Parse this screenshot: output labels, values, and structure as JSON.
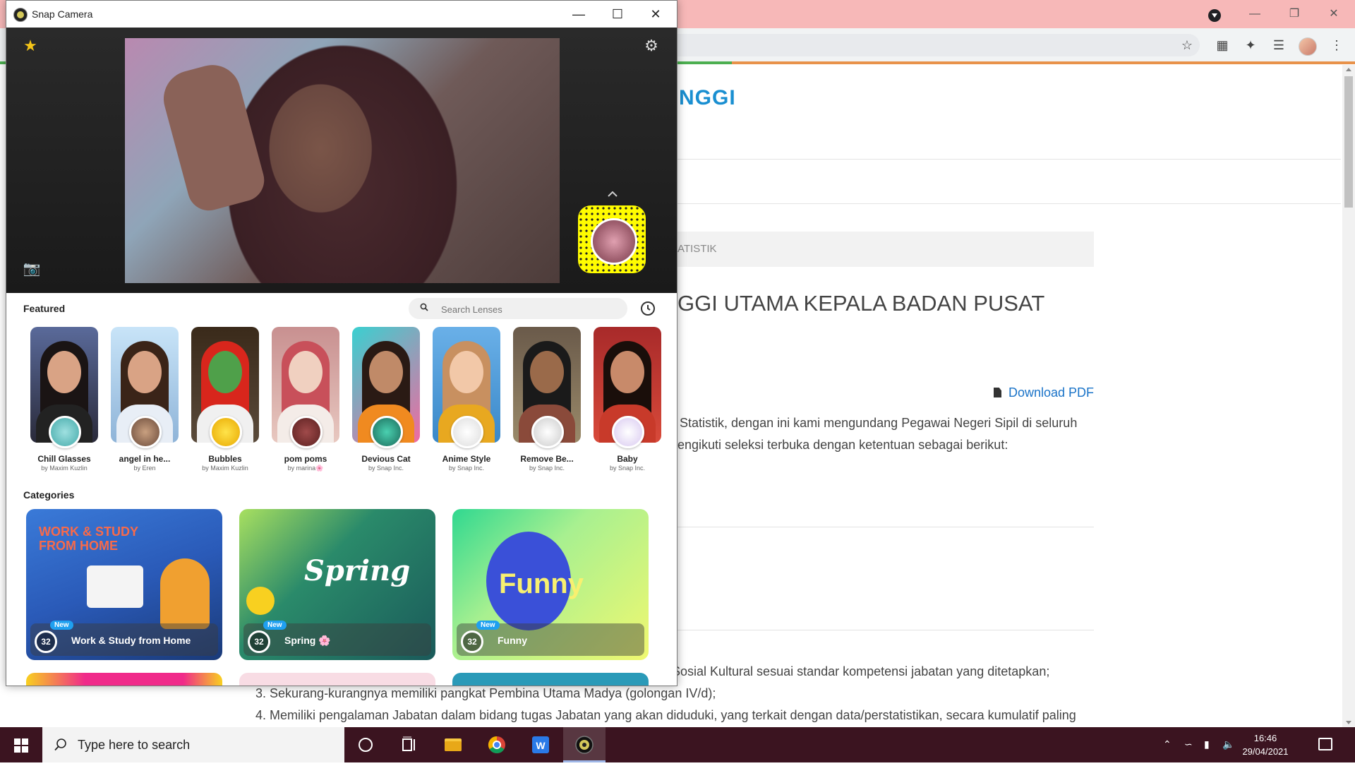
{
  "browser": {
    "site_title": "NGGI",
    "breadcrumb": "ATISTIK",
    "article_title": "GGI UTAMA KEPALA BADAN PUSAT",
    "download_label": "Download PDF",
    "paragraphs": [
      "Statistik, dengan ini kami mengundang Pegawai Negeri Sipil di seluruh",
      "engikuti seleksi terbuka dengan ketentuan sebagai berikut:",
      "Sosial Kultural sesuai standar kompetensi jabatan yang ditetapkan;",
      "3. Sekurang-kurangnya memiliki pangkat Pembina Utama Madya (golongan IV/d);",
      "4. Memiliki pengalaman Jabatan dalam bidang tugas Jabatan yang akan diduduki, yang terkait dengan data/perstatistikan, secara kumulatif paling"
    ]
  },
  "snap": {
    "title": "Snap Camera",
    "featured_label": "Featured",
    "search_placeholder": "Search Lenses",
    "categories_label": "Categories",
    "lenses": [
      {
        "name": "Chill Glasses",
        "by": "by Maxim Kuzlin"
      },
      {
        "name": "angel in he...",
        "by": "by Eren"
      },
      {
        "name": "Bubbles",
        "by": "by Maxim Kuzlin"
      },
      {
        "name": "pom poms",
        "by": "by marina🌸"
      },
      {
        "name": "Devious Cat",
        "by": "by Snap Inc."
      },
      {
        "name": "Anime Style",
        "by": "by Snap Inc."
      },
      {
        "name": "Remove Be...",
        "by": "by Snap Inc."
      },
      {
        "name": "Baby",
        "by": "by Snap Inc."
      }
    ],
    "categories": [
      {
        "label": "Work & Study from Home",
        "count": "32",
        "badge": "New",
        "art": "WORK & STUDY FROM HOME"
      },
      {
        "label": "Spring 🌸",
        "count": "32",
        "badge": "New",
        "art": "Spring"
      },
      {
        "label": "Funny",
        "count": "32",
        "badge": "New",
        "art": "Funny"
      }
    ]
  },
  "taskbar": {
    "search_placeholder": "Type here to search",
    "time": "16:46",
    "date": "29/04/2021"
  },
  "colors": {
    "snap_yellow": "#fffc00",
    "taskbar_bg": "#3b1420",
    "chrome_titlebar": "#f7b8b8",
    "link_blue": "#1a73c8",
    "site_title_blue": "#1a8fd1",
    "new_badge": "#1fa0f0"
  }
}
